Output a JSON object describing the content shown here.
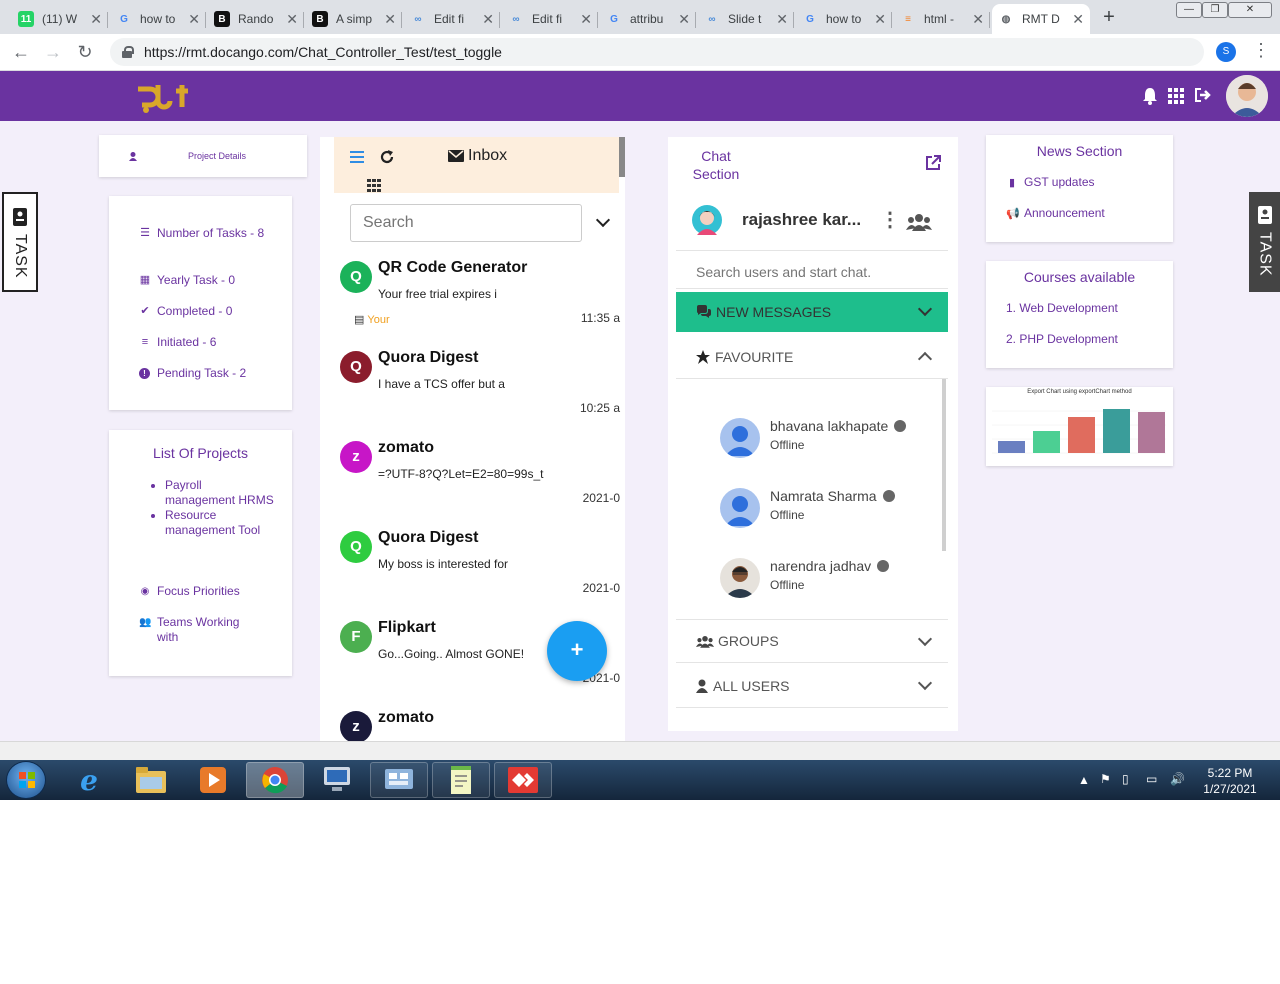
{
  "browser": {
    "tabs": [
      {
        "title": "(11) W",
        "icon": "whatsapp-icon",
        "color": "#25d366",
        "glyph": "11"
      },
      {
        "title": "how to",
        "icon": "google-icon",
        "color": "#4285f4",
        "glyph": "G"
      },
      {
        "title": "Rando",
        "icon": "codepen-icon",
        "color": "#111111",
        "glyph": "B"
      },
      {
        "title": "A simp",
        "icon": "codepen-icon",
        "color": "#111111",
        "glyph": "B"
      },
      {
        "title": "Edit fi",
        "icon": "cloud-icon",
        "color": "#4a8bd8",
        "glyph": "∞"
      },
      {
        "title": "Edit fi",
        "icon": "cloud-icon",
        "color": "#4a8bd8",
        "glyph": "∞"
      },
      {
        "title": "attribu",
        "icon": "google-icon",
        "color": "#4285f4",
        "glyph": "G"
      },
      {
        "title": "Slide t",
        "icon": "cloud-icon",
        "color": "#4a8bd8",
        "glyph": "∞"
      },
      {
        "title": "how to",
        "icon": "google-icon",
        "color": "#4285f4",
        "glyph": "G"
      },
      {
        "title": "html -",
        "icon": "stackoverflow-icon",
        "color": "#f48024",
        "glyph": "≡"
      },
      {
        "title": "RMT D",
        "icon": "globe-icon",
        "color": "#5f6368",
        "glyph": "◍"
      }
    ],
    "url": "https://rmt.docango.com/Chat_Controller_Test/test_toggle",
    "profile_initial": "S"
  },
  "left": {
    "project_details": "Project Details",
    "task_tab": "TASK",
    "stats": [
      {
        "label": "Number of Tasks - 8",
        "icon": "list-check-icon",
        "glyph": "☰"
      },
      {
        "label": "Yearly Task - 0",
        "icon": "calendar-icon",
        "glyph": "▦"
      },
      {
        "label": "Completed - 0",
        "icon": "check-icon",
        "glyph": "✔"
      },
      {
        "label": "Initiated - 6",
        "icon": "bars-icon",
        "glyph": "≡"
      },
      {
        "label": "Pending Task - 2",
        "icon": "exclamation-circle-icon",
        "glyph": "!"
      }
    ],
    "projects_title": "List Of Projects",
    "projects": [
      "Payroll management HRMS",
      "Resource management Tool"
    ],
    "links": [
      {
        "label": "Focus Priorities",
        "icon": "eye-icon",
        "glyph": "◉"
      },
      {
        "label": "Teams Working with",
        "icon": "users-icon",
        "glyph": "👥"
      }
    ]
  },
  "inbox": {
    "title": "Inbox",
    "search_placeholder": "Search",
    "add_label": "+",
    "mails": [
      {
        "initial": "Q",
        "from": "QR Code Generator",
        "snippet": "Your free trial expires i",
        "time": "11:35 a",
        "tag": "Your",
        "color": "#1bb25a"
      },
      {
        "initial": "Q",
        "from": "Quora Digest",
        "snippet": "I have a TCS offer but a",
        "time": "10:25 a",
        "tag": "",
        "color": "#8b1c2c"
      },
      {
        "initial": "z",
        "from": "zomato",
        "snippet": "=?UTF-8?Q?Let=E2=80=99s_t",
        "time": "2021-0",
        "tag": "",
        "color": "#c716c7"
      },
      {
        "initial": "Q",
        "from": "Quora Digest",
        "snippet": "My boss is interested for",
        "time": "2021-0",
        "tag": "",
        "color": "#2ecc40"
      },
      {
        "initial": "F",
        "from": "Flipkart",
        "snippet": "Go...Going.. Almost GONE!",
        "time": "2021-0",
        "tag": "",
        "color": "#4caf50"
      },
      {
        "initial": "z",
        "from": "zomato",
        "snippet": "",
        "time": "",
        "tag": "",
        "color": "#1a1a3a"
      }
    ]
  },
  "chat": {
    "title": "Chat Section",
    "user_name": "rajashree kar...",
    "search_placeholder": "Search users and start chat.",
    "new_messages": "NEW MESSAGES",
    "favourite": "FAVOURITE",
    "groups": "GROUPS",
    "all_users": "ALL USERS",
    "accent": "#1ebe8c",
    "users": [
      {
        "name": "bhavana lakhapate",
        "status": "Offline",
        "photo": false
      },
      {
        "name": "Namrata Sharma",
        "status": "Offline",
        "photo": false
      },
      {
        "name": "narendra jadhav",
        "status": "Offline",
        "photo": true
      }
    ]
  },
  "news": {
    "title": "News Section",
    "items": [
      {
        "label": "GST updates",
        "icon": "book-icon",
        "glyph": "▮"
      },
      {
        "label": "Announcement",
        "icon": "megaphone-icon",
        "glyph": "📢"
      }
    ],
    "courses_title": "Courses available",
    "courses": [
      "1. Web Development",
      "2. PHP Development"
    ],
    "chart_title": "Export Chart using exportChart method"
  },
  "chart_data": {
    "type": "bar",
    "title": "Export Chart using exportChart method",
    "values": [
      12,
      22,
      36,
      44,
      41
    ],
    "colors": [
      "#6a7fc1",
      "#4ccf93",
      "#e06c5e",
      "#3a9d9a",
      "#b07798"
    ]
  },
  "taskbar": {
    "time": "5:22 PM",
    "date": "1/27/2021",
    "right_tab": "TASK"
  }
}
